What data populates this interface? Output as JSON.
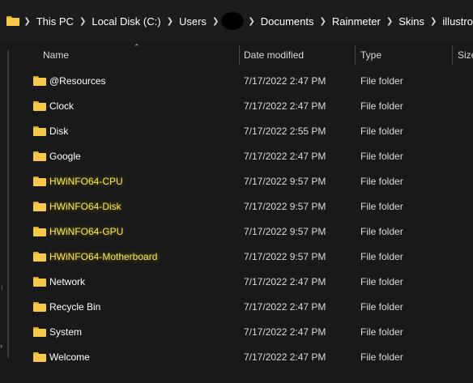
{
  "breadcrumb": {
    "items": [
      "This PC",
      "Local Disk (C:)",
      "Users",
      "",
      "Documents",
      "Rainmeter",
      "Skins",
      "illustro"
    ],
    "separator": ">"
  },
  "columns": {
    "name": "Name",
    "date_modified": "Date modified",
    "type": "Type",
    "size": "Size",
    "sorted_by": "Name"
  },
  "files": [
    {
      "name": "@Resources",
      "date": "7/17/2022 2:47 PM",
      "type": "File folder",
      "highlighted": false
    },
    {
      "name": "Clock",
      "date": "7/17/2022 2:47 PM",
      "type": "File folder",
      "highlighted": false
    },
    {
      "name": "Disk",
      "date": "7/17/2022 2:55 PM",
      "type": "File folder",
      "highlighted": false
    },
    {
      "name": "Google",
      "date": "7/17/2022 2:47 PM",
      "type": "File folder",
      "highlighted": false
    },
    {
      "name": "HWiNFO64-CPU",
      "date": "7/17/2022 9:57 PM",
      "type": "File folder",
      "highlighted": true
    },
    {
      "name": "HWiNFO64-Disk",
      "date": "7/17/2022 9:57 PM",
      "type": "File folder",
      "highlighted": true
    },
    {
      "name": "HWiNFO64-GPU",
      "date": "7/17/2022 9:57 PM",
      "type": "File folder",
      "highlighted": true
    },
    {
      "name": "HWiNFO64-Motherboard",
      "date": "7/17/2022 9:57 PM",
      "type": "File folder",
      "highlighted": true
    },
    {
      "name": "Network",
      "date": "7/17/2022 2:47 PM",
      "type": "File folder",
      "highlighted": false
    },
    {
      "name": "Recycle Bin",
      "date": "7/17/2022 2:47 PM",
      "type": "File folder",
      "highlighted": false
    },
    {
      "name": "System",
      "date": "7/17/2022 2:47 PM",
      "type": "File folder",
      "highlighted": false
    },
    {
      "name": "Welcome",
      "date": "7/17/2022 2:47 PM",
      "type": "File folder",
      "highlighted": false
    }
  ],
  "colors": {
    "background": "#191919",
    "folder": "#f7c948",
    "highlight_text": "#ffe84a"
  },
  "icons": {
    "folder": "folder-icon",
    "breadcrumb_separator": "chevron-right-icon",
    "sort": "chevron-up-icon"
  }
}
